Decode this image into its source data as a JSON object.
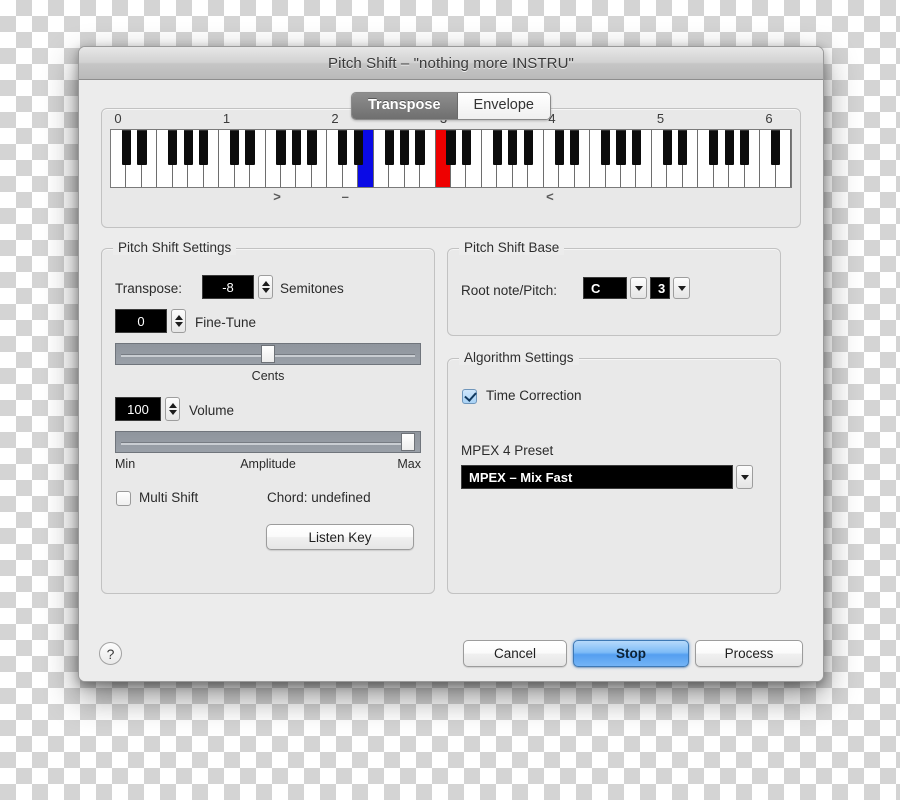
{
  "window": {
    "title": "Pitch Shift – \"nothing more INSTRU\""
  },
  "tabs": [
    {
      "label": "Transpose",
      "selected": true
    },
    {
      "label": "Envelope",
      "selected": false
    }
  ],
  "keyboard": {
    "octave_labels": [
      "0",
      "1",
      "2",
      "3",
      "4",
      "5",
      "6"
    ],
    "markers": [
      {
        "glyph": ">",
        "pos_pct": 24.5
      },
      {
        "glyph": "–",
        "pos_pct": 34.5
      },
      {
        "glyph": "<",
        "pos_pct": 64.5
      }
    ],
    "white_key_count": 44,
    "highlight_blue_white_index": 16,
    "highlight_red_white_index": 21,
    "colors": {
      "blue": "#0a0ae6",
      "red": "#ee0000"
    }
  },
  "pitch_shift_settings": {
    "title": "Pitch Shift Settings",
    "transpose_label": "Transpose:",
    "transpose_value": "-8",
    "semitones_label": "Semitones",
    "fine_tune_value": "0",
    "fine_tune_label": "Fine-Tune",
    "cents_label": "Cents",
    "cents_slider_pct": 50,
    "volume_value": "100",
    "volume_label": "Volume",
    "amplitude_min_label": "Min",
    "amplitude_label": "Amplitude",
    "amplitude_max_label": "Max",
    "amplitude_slider_pct": 96,
    "multi_shift_label": "Multi Shift",
    "multi_shift_checked": false,
    "chord_label": "Chord: undefined",
    "listen_key_label": "Listen Key"
  },
  "pitch_shift_base": {
    "title": "Pitch Shift Base",
    "root_note_label": "Root note/Pitch:",
    "root_note_value": "C",
    "pitch_value": "3"
  },
  "algorithm_settings": {
    "title": "Algorithm Settings",
    "time_correction_label": "Time Correction",
    "time_correction_checked": true,
    "preset_label": "MPEX 4 Preset",
    "preset_value": "MPEX – Mix Fast"
  },
  "footer": {
    "help_label": "?",
    "cancel_label": "Cancel",
    "stop_label": "Stop",
    "process_label": "Process"
  }
}
